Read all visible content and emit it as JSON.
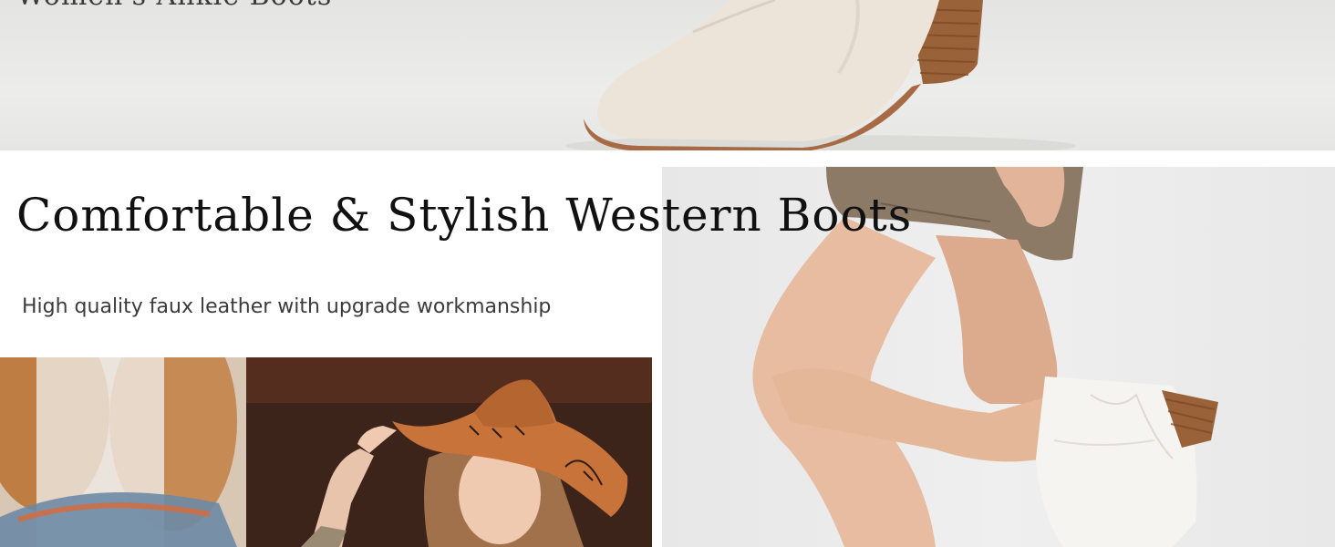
{
  "banner": {
    "top_caption": "Women's Ankle Boots",
    "headline": "Comfortable & Stylish Western Boots",
    "subline": "High quality faux leather with upgrade workmanship"
  },
  "images": {
    "top": "cream-suede-ankle-boot-photo",
    "right": "white-western-boot-on-leg-photo",
    "bottom_left": "woman-in-cowboy-hat-photo"
  },
  "colors": {
    "headline": "#111111",
    "subline": "#3b3b3b",
    "boot_cream": "#ece4d9",
    "heel_wood": "#9a6238",
    "hat_orange": "#c8733a"
  }
}
